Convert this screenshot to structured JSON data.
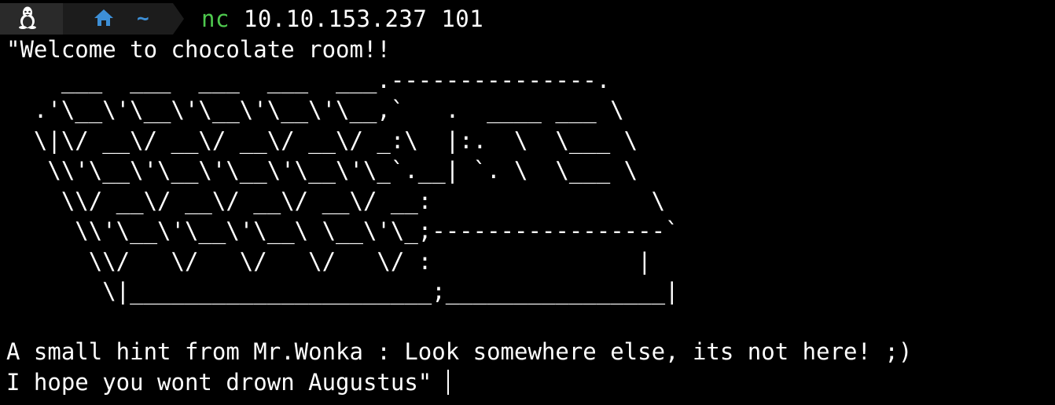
{
  "prompt": {
    "os_icon": "linux-penguin-icon",
    "dir_icon": "home-icon",
    "dir_label": "~",
    "command_name": "nc",
    "command_args": " 10.10.153.237 101"
  },
  "colors": {
    "background": "#000000",
    "text": "#ffffff",
    "command": "#4ec94e",
    "home_icon": "#3d8fd6",
    "tilde": "#3d8fd6"
  },
  "output": {
    "line_1": "\"Welcome to chocolate room!!",
    "ascii_art": [
      "    ___  ___  ___  ___  ___.---------------.",
      "  .'\\__\\'\\__\\'\\__\\'\\__\\'\\__,`   .  ____ ___ \\",
      "  \\|\\/ __\\/ __\\/ __\\/ __\\/ _:\\  |:.  \\  \\___ \\",
      "   \\\\'\\__\\'\\__\\'\\__\\'\\__\\'\\_`.__| `. \\  \\___ \\",
      "    \\\\/ __\\/ __\\/ __\\/ __\\/ __:                \\",
      "     \\\\'\\__\\'\\__\\'\\__\\ \\__\\'\\_;-----------------`",
      "      \\\\/   \\/   \\/   \\/   \\/ :               |",
      "       \\|______________________;________________|"
    ],
    "blank": "",
    "hint": "A small hint from Mr.Wonka : Look somewhere else, its not here! ;)",
    "last": "I hope you wont drown Augustus\" "
  }
}
